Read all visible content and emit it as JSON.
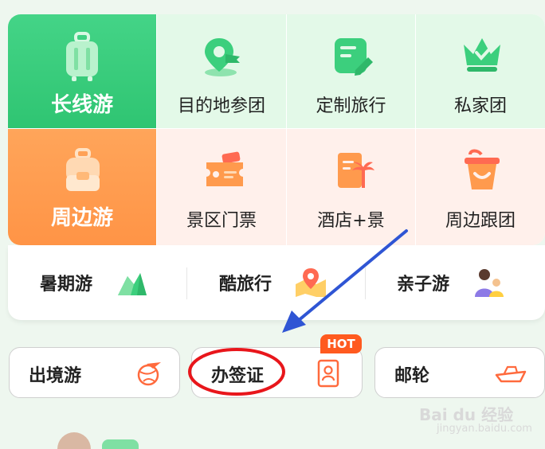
{
  "grid": {
    "row1": [
      {
        "label": "长线游",
        "icon": "suitcase-icon"
      },
      {
        "label": "目的地参团",
        "icon": "map-pin-flag-icon"
      },
      {
        "label": "定制旅行",
        "icon": "edit-note-icon"
      },
      {
        "label": "私家团",
        "icon": "crown-icon"
      }
    ],
    "row2": [
      {
        "label": "周边游",
        "icon": "backpack-icon"
      },
      {
        "label": "景区门票",
        "icon": "ticket-icon"
      },
      {
        "label": "酒店+景",
        "icon": "hotel-palm-icon"
      },
      {
        "label": "周边跟团",
        "icon": "bucket-smile-icon"
      }
    ]
  },
  "subnav": [
    {
      "label": "暑期游",
      "icon": "mountain-icon"
    },
    {
      "label": "酷旅行",
      "icon": "map-location-icon"
    },
    {
      "label": "亲子游",
      "icon": "parent-child-icon"
    }
  ],
  "quick": [
    {
      "label": "出境游",
      "icon": "globe-plane-icon"
    },
    {
      "label": "办签证",
      "icon": "passport-icon",
      "badge": "HOT"
    },
    {
      "label": "邮轮",
      "icon": "cruise-ship-icon"
    }
  ],
  "watermark": {
    "brand": "Bai du 经验",
    "url": "jingyan.baidu.com"
  },
  "colors": {
    "green": "#3ccf7d",
    "orange": "#ff9a4d",
    "light_green": "#e3f9e8",
    "light_orange": "#fff0eb",
    "hot": "#ff5a1f",
    "annotation_red": "#e8161b",
    "arrow_blue": "#2f55d4"
  }
}
